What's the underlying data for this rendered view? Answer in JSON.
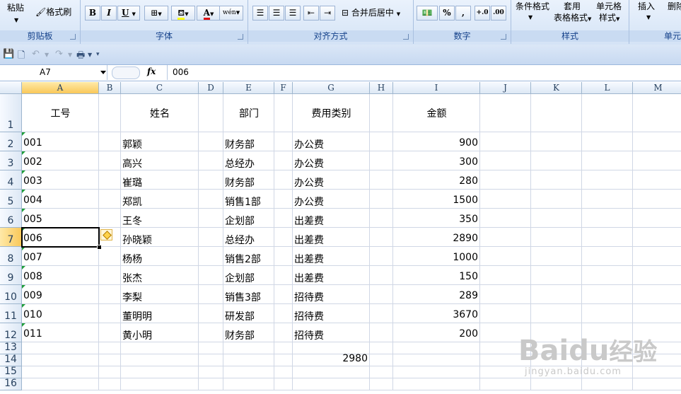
{
  "ribbon": {
    "clipboard": {
      "paste": "粘贴",
      "format_painter": "格式刷",
      "label": "剪贴板"
    },
    "font": {
      "label": "字体",
      "bold": "B",
      "italic": "I",
      "underline": "U",
      "font_color_glyph": "A",
      "wen": "wén"
    },
    "alignment": {
      "label": "对齐方式",
      "merge_center": "合并后居中"
    },
    "number": {
      "label": "数字",
      "percent": "%",
      "comma": ","
    },
    "styles": {
      "label": "样式",
      "conditional_format": "条件格式",
      "apply": "套用",
      "table_format": "表格格式",
      "cell": "单元格",
      "cell_style": "样式"
    },
    "cells": {
      "insert": "插入",
      "delete": "删除",
      "label": "单元"
    }
  },
  "formula_bar": {
    "name_box": "A7",
    "fx": "fx",
    "value": "006"
  },
  "columns": [
    "A",
    "B",
    "C",
    "D",
    "E",
    "F",
    "G",
    "H",
    "I",
    "J",
    "K",
    "L",
    "M"
  ],
  "selected_column": "A",
  "rows": [
    "1",
    "2",
    "3",
    "4",
    "5",
    "6",
    "7",
    "8",
    "9",
    "10",
    "11",
    "12",
    "13",
    "14",
    "15",
    "16"
  ],
  "selected_row": "7",
  "headers": {
    "a": "工号",
    "c": "姓名",
    "e": "部门",
    "g": "费用类别",
    "i": "金额"
  },
  "records": [
    {
      "id": "001",
      "name": "郭颖",
      "dept": "财务部",
      "category": "办公费",
      "amount": "900"
    },
    {
      "id": "002",
      "name": "高兴",
      "dept": "总经办",
      "category": "办公费",
      "amount": "300"
    },
    {
      "id": "003",
      "name": "崔璐",
      "dept": "财务部",
      "category": "办公费",
      "amount": "280"
    },
    {
      "id": "004",
      "name": "郑凯",
      "dept": "销售1部",
      "category": "办公费",
      "amount": "1500"
    },
    {
      "id": "005",
      "name": "王冬",
      "dept": "企划部",
      "category": "出差费",
      "amount": "350"
    },
    {
      "id": "006",
      "name": "孙晓颖",
      "dept": "总经办",
      "category": "出差费",
      "amount": "2890"
    },
    {
      "id": "007",
      "name": "杨杨",
      "dept": "销售2部",
      "category": "出差费",
      "amount": "1000"
    },
    {
      "id": "008",
      "name": "张杰",
      "dept": "企划部",
      "category": "出差费",
      "amount": "150"
    },
    {
      "id": "009",
      "name": "李梨",
      "dept": "销售3部",
      "category": "招待费",
      "amount": "289"
    },
    {
      "id": "010",
      "name": "董明明",
      "dept": "研发部",
      "category": "招待费",
      "amount": "3670"
    },
    {
      "id": "011",
      "name": "黄小明",
      "dept": "财务部",
      "category": "招待费",
      "amount": "200"
    }
  ],
  "g14_value": "2980",
  "watermark": {
    "brand": "Baidu",
    "cn": "经验",
    "url": "jingyan.baidu.com"
  },
  "colors": {
    "selection_header": "#f9c859",
    "ribbon_label": "#15428b",
    "error_triangle": "#1f9e3a"
  }
}
